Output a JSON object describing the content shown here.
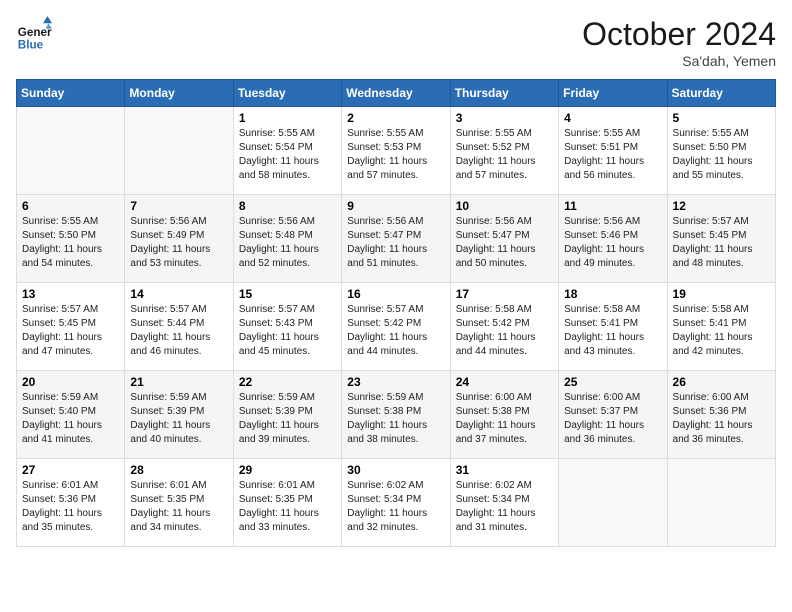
{
  "header": {
    "logo_line1": "General",
    "logo_line2": "Blue",
    "month_title": "October 2024",
    "location": "Sa'dah, Yemen"
  },
  "weekdays": [
    "Sunday",
    "Monday",
    "Tuesday",
    "Wednesday",
    "Thursday",
    "Friday",
    "Saturday"
  ],
  "weeks": [
    [
      {
        "day": "",
        "empty": true
      },
      {
        "day": "",
        "empty": true
      },
      {
        "day": "1",
        "sunrise": "5:55 AM",
        "sunset": "5:54 PM",
        "daylight": "11 hours and 58 minutes."
      },
      {
        "day": "2",
        "sunrise": "5:55 AM",
        "sunset": "5:53 PM",
        "daylight": "11 hours and 57 minutes."
      },
      {
        "day": "3",
        "sunrise": "5:55 AM",
        "sunset": "5:52 PM",
        "daylight": "11 hours and 57 minutes."
      },
      {
        "day": "4",
        "sunrise": "5:55 AM",
        "sunset": "5:51 PM",
        "daylight": "11 hours and 56 minutes."
      },
      {
        "day": "5",
        "sunrise": "5:55 AM",
        "sunset": "5:50 PM",
        "daylight": "11 hours and 55 minutes."
      }
    ],
    [
      {
        "day": "6",
        "sunrise": "5:55 AM",
        "sunset": "5:50 PM",
        "daylight": "11 hours and 54 minutes."
      },
      {
        "day": "7",
        "sunrise": "5:56 AM",
        "sunset": "5:49 PM",
        "daylight": "11 hours and 53 minutes."
      },
      {
        "day": "8",
        "sunrise": "5:56 AM",
        "sunset": "5:48 PM",
        "daylight": "11 hours and 52 minutes."
      },
      {
        "day": "9",
        "sunrise": "5:56 AM",
        "sunset": "5:47 PM",
        "daylight": "11 hours and 51 minutes."
      },
      {
        "day": "10",
        "sunrise": "5:56 AM",
        "sunset": "5:47 PM",
        "daylight": "11 hours and 50 minutes."
      },
      {
        "day": "11",
        "sunrise": "5:56 AM",
        "sunset": "5:46 PM",
        "daylight": "11 hours and 49 minutes."
      },
      {
        "day": "12",
        "sunrise": "5:57 AM",
        "sunset": "5:45 PM",
        "daylight": "11 hours and 48 minutes."
      }
    ],
    [
      {
        "day": "13",
        "sunrise": "5:57 AM",
        "sunset": "5:45 PM",
        "daylight": "11 hours and 47 minutes."
      },
      {
        "day": "14",
        "sunrise": "5:57 AM",
        "sunset": "5:44 PM",
        "daylight": "11 hours and 46 minutes."
      },
      {
        "day": "15",
        "sunrise": "5:57 AM",
        "sunset": "5:43 PM",
        "daylight": "11 hours and 45 minutes."
      },
      {
        "day": "16",
        "sunrise": "5:57 AM",
        "sunset": "5:42 PM",
        "daylight": "11 hours and 44 minutes."
      },
      {
        "day": "17",
        "sunrise": "5:58 AM",
        "sunset": "5:42 PM",
        "daylight": "11 hours and 44 minutes."
      },
      {
        "day": "18",
        "sunrise": "5:58 AM",
        "sunset": "5:41 PM",
        "daylight": "11 hours and 43 minutes."
      },
      {
        "day": "19",
        "sunrise": "5:58 AM",
        "sunset": "5:41 PM",
        "daylight": "11 hours and 42 minutes."
      }
    ],
    [
      {
        "day": "20",
        "sunrise": "5:59 AM",
        "sunset": "5:40 PM",
        "daylight": "11 hours and 41 minutes."
      },
      {
        "day": "21",
        "sunrise": "5:59 AM",
        "sunset": "5:39 PM",
        "daylight": "11 hours and 40 minutes."
      },
      {
        "day": "22",
        "sunrise": "5:59 AM",
        "sunset": "5:39 PM",
        "daylight": "11 hours and 39 minutes."
      },
      {
        "day": "23",
        "sunrise": "5:59 AM",
        "sunset": "5:38 PM",
        "daylight": "11 hours and 38 minutes."
      },
      {
        "day": "24",
        "sunrise": "6:00 AM",
        "sunset": "5:38 PM",
        "daylight": "11 hours and 37 minutes."
      },
      {
        "day": "25",
        "sunrise": "6:00 AM",
        "sunset": "5:37 PM",
        "daylight": "11 hours and 36 minutes."
      },
      {
        "day": "26",
        "sunrise": "6:00 AM",
        "sunset": "5:36 PM",
        "daylight": "11 hours and 36 minutes."
      }
    ],
    [
      {
        "day": "27",
        "sunrise": "6:01 AM",
        "sunset": "5:36 PM",
        "daylight": "11 hours and 35 minutes."
      },
      {
        "day": "28",
        "sunrise": "6:01 AM",
        "sunset": "5:35 PM",
        "daylight": "11 hours and 34 minutes."
      },
      {
        "day": "29",
        "sunrise": "6:01 AM",
        "sunset": "5:35 PM",
        "daylight": "11 hours and 33 minutes."
      },
      {
        "day": "30",
        "sunrise": "6:02 AM",
        "sunset": "5:34 PM",
        "daylight": "11 hours and 32 minutes."
      },
      {
        "day": "31",
        "sunrise": "6:02 AM",
        "sunset": "5:34 PM",
        "daylight": "11 hours and 31 minutes."
      },
      {
        "day": "",
        "empty": true
      },
      {
        "day": "",
        "empty": true
      }
    ]
  ],
  "labels": {
    "sunrise_prefix": "Sunrise: ",
    "sunset_prefix": "Sunset: ",
    "daylight_prefix": "Daylight: "
  }
}
